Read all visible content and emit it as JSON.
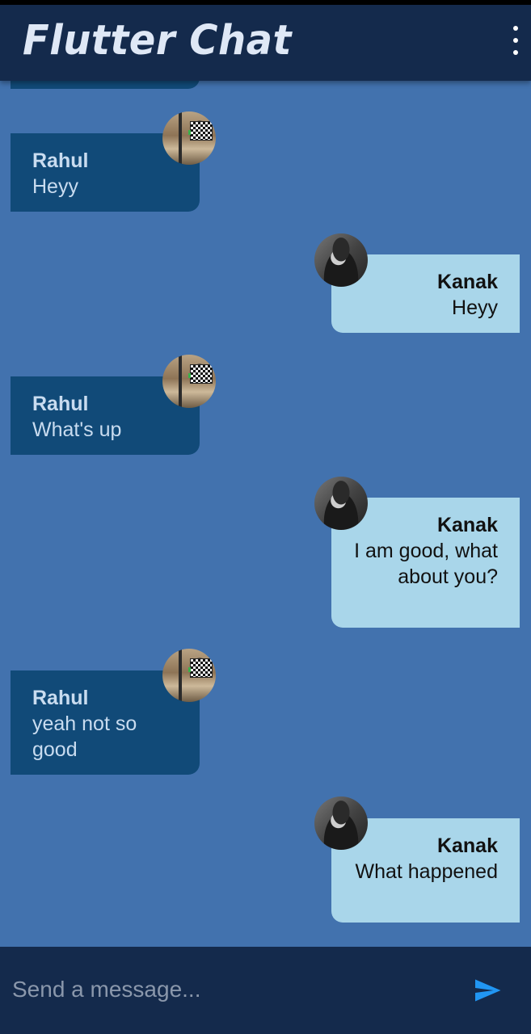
{
  "app": {
    "title": "Flutter Chat",
    "menu_icon": "more-vert-icon"
  },
  "colors": {
    "background": "#4272ae",
    "appbar": "#142a4c",
    "incoming_bubble": "#114a78",
    "outgoing_bubble": "#a9d6ea",
    "send_accent": "#2196f3"
  },
  "messages": [
    {
      "sender": "Rahul",
      "text": "Heyy",
      "direction": "incoming",
      "avatar": "rahul-avatar"
    },
    {
      "sender": "Kanak",
      "text": "Heyy",
      "direction": "outgoing",
      "avatar": "kanak-avatar"
    },
    {
      "sender": "Rahul",
      "text": "What's up",
      "direction": "incoming",
      "avatar": "rahul-avatar"
    },
    {
      "sender": "Kanak",
      "text": "I am good, what about you?",
      "direction": "outgoing",
      "avatar": "kanak-avatar"
    },
    {
      "sender": "Rahul",
      "text": "yeah not so good",
      "direction": "incoming",
      "avatar": "rahul-avatar"
    },
    {
      "sender": "Kanak",
      "text": "What happened",
      "direction": "outgoing",
      "avatar": "kanak-avatar"
    }
  ],
  "composer": {
    "placeholder": "Send a message...",
    "value": "",
    "send_icon": "send-icon"
  }
}
